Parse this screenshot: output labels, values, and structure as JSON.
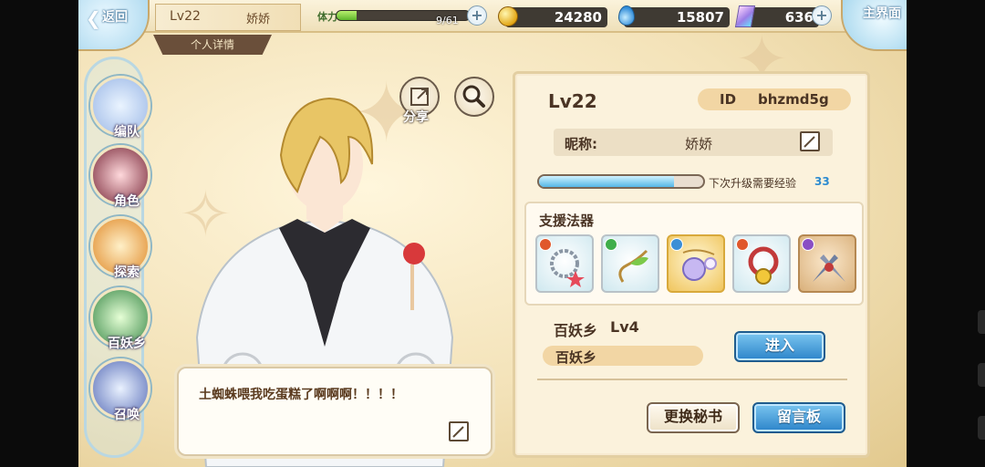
{
  "topbar": {
    "back_label": "返回",
    "level": "Lv22",
    "player_name": "娇娇",
    "detail_tab": "个人详情",
    "stamina_label": "体力",
    "stamina_value": "9/61",
    "stamina_fraction": 0.15,
    "gold": "24280",
    "spirit": "15807",
    "gems": "636",
    "home_label": "主界面",
    "plus_symbol": "+"
  },
  "nav": {
    "items": [
      {
        "label": "编队",
        "icon": "team-icon"
      },
      {
        "label": "角色",
        "icon": "character-icon"
      },
      {
        "label": "探索",
        "icon": "explore-icon"
      },
      {
        "label": "百妖乡",
        "icon": "village-icon"
      },
      {
        "label": "召唤",
        "icon": "summon-icon"
      }
    ]
  },
  "character": {
    "share_label": "分享",
    "speech": "土蜘蛛喂我吃蛋糕了啊啊啊！！！！"
  },
  "profile": {
    "level": "Lv22",
    "id_label": "ID",
    "id_value": "bhzmd5g",
    "nick_label": "昵称:",
    "nick_value": "娇娇",
    "exp_label": "下次升级需要经验",
    "exp_value": "33",
    "exp_fraction": 0.82,
    "support_title": "支援法器",
    "artifacts": [
      {
        "rarity": "silver",
        "badge_color": "#e0582c",
        "icon": "star-bracelet-icon"
      },
      {
        "rarity": "silver",
        "badge_color": "#3fae4a",
        "icon": "leaf-hook-icon"
      },
      {
        "rarity": "gold",
        "badge_color": "#3b8fd6",
        "icon": "orb-necklace-icon"
      },
      {
        "rarity": "silver",
        "badge_color": "#e0582c",
        "icon": "bell-collar-icon"
      },
      {
        "rarity": "bronze",
        "badge_color": "#8a4fc4",
        "icon": "blade-pair-icon"
      }
    ],
    "town_name": "百妖乡",
    "town_level": "Lv4",
    "town_pill": "百妖乡",
    "enter_label": "进入",
    "swap_label": "更换秘书",
    "board_label": "留言板"
  }
}
